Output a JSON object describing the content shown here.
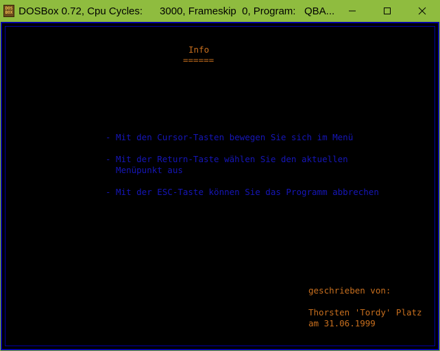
{
  "window": {
    "title": "DOSBox 0.72, Cpu Cycles:      3000, Frameskip  0, Program:   QBA...",
    "icon_text_top": "DOS",
    "icon_text_bottom": "BOX",
    "controls": [
      "minimize-icon",
      "maximize-icon",
      "close-icon"
    ]
  },
  "screen": {
    "heading": "Info",
    "heading_underline": "======",
    "instructions": [
      "- Mit den Cursor-Tasten bewegen Sie sich im Menü",
      "- Mit der Return-Taste wählen Sie den aktuellen",
      "  Menüpunkt aus",
      "- Mit der ESC-Taste können Sie das Programm abbrechen"
    ],
    "author_label": "geschrieben von:",
    "author_name": "Thorsten 'Tordy' Platz",
    "author_date": "am 31.06.1999"
  },
  "colors": {
    "titlebar": "#8fbc3f",
    "text_orange": "#c86f1e",
    "text_blue": "#1616b8",
    "border_blue": "#0000a8",
    "background": "#000000"
  }
}
